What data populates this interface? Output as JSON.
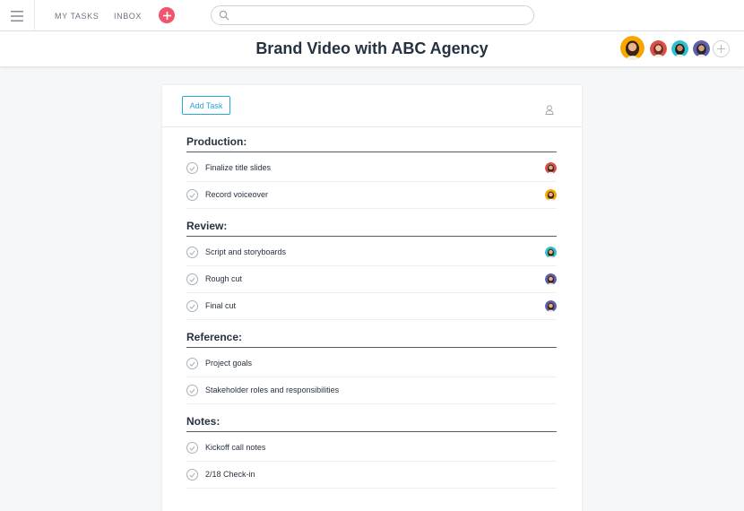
{
  "topbar": {
    "nav": [
      "MY TASKS",
      "INBOX"
    ],
    "search_value": "",
    "icons": [
      "menu-icon",
      "plus-icon",
      "search-icon"
    ]
  },
  "header": {
    "title": "Brand Video with ABC Agency",
    "member_colors": [
      "#f7a600",
      "#d9504a",
      "#2ec1cf",
      "#5d5fa8"
    ]
  },
  "toolbar": {
    "add_task_label": "Add Task"
  },
  "sections": [
    {
      "title": "Production:",
      "tasks": [
        {
          "name": "Finalize title slides",
          "assignee_color": "#d9504a"
        },
        {
          "name": "Record voiceover",
          "assignee_color": "#f7a600"
        }
      ]
    },
    {
      "title": "Review:",
      "tasks": [
        {
          "name": "Script and storyboards",
          "assignee_color": "#2ec1cf"
        },
        {
          "name": "Rough cut",
          "assignee_color": "#5d5fa8"
        },
        {
          "name": "Final cut",
          "assignee_color": "#5d5fa8"
        }
      ]
    },
    {
      "title": "Reference:",
      "tasks": [
        {
          "name": "Project goals",
          "assignee_color": ""
        },
        {
          "name": "Stakeholder roles and responsibilities",
          "assignee_color": ""
        }
      ]
    },
    {
      "title": "Notes:",
      "tasks": [
        {
          "name": "Kickoff call notes",
          "assignee_color": ""
        },
        {
          "name": "2/18 Check-in",
          "assignee_color": ""
        }
      ]
    }
  ]
}
